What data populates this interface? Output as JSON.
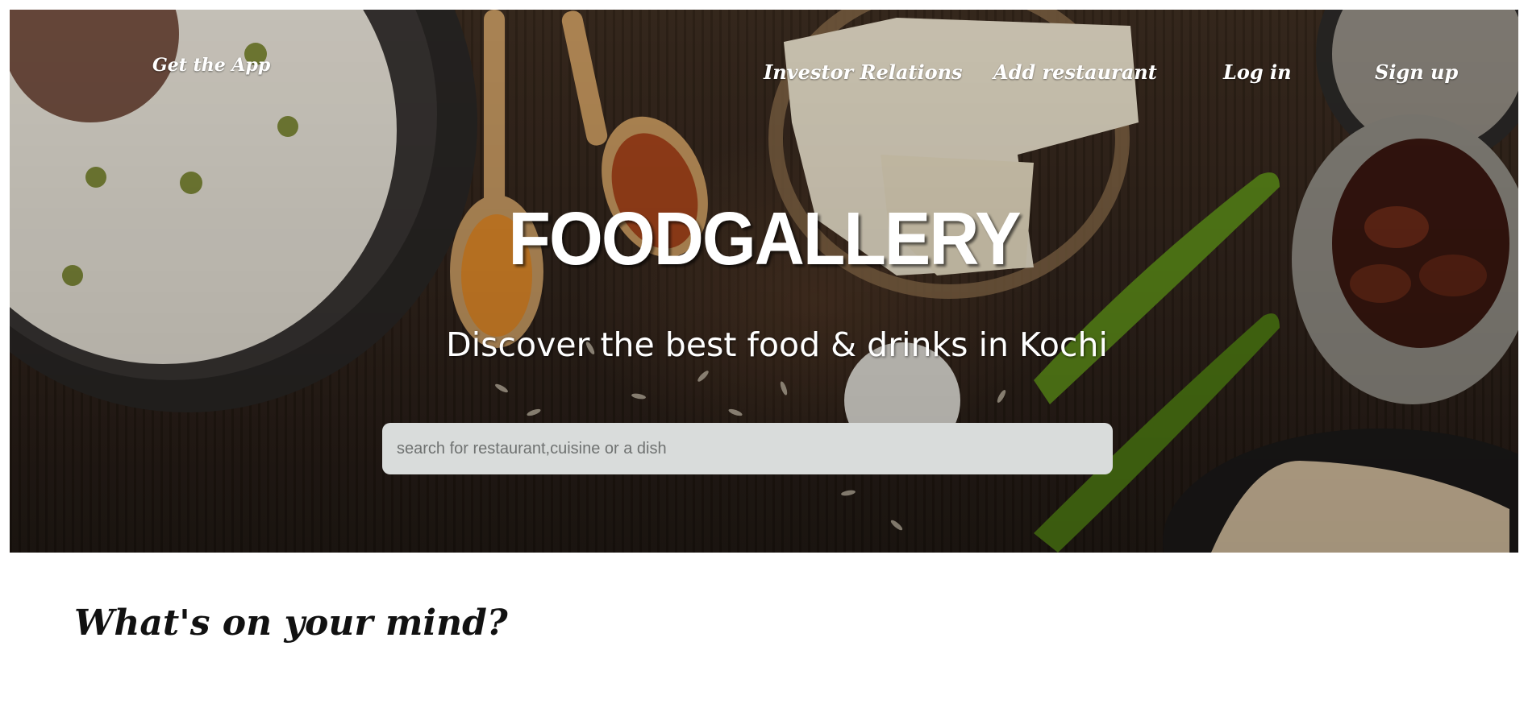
{
  "header": {
    "get_app": "Get the App",
    "nav": {
      "investor_relations": "Investor Relations",
      "add_restaurant": "Add restaurant",
      "login": "Log in",
      "signup": "Sign up"
    }
  },
  "hero": {
    "brand": "FOODGALLERY",
    "tagline": "Discover the best food & drinks in Kochi",
    "search": {
      "placeholder": "search for restaurant,cuisine or a dish",
      "value": ""
    }
  },
  "sections": {
    "mind_title": "What's on your mind?"
  },
  "colors": {
    "search_bg": "#d9dcdb",
    "text_dark": "#111111",
    "hero_wood": "#3a2a1e"
  }
}
